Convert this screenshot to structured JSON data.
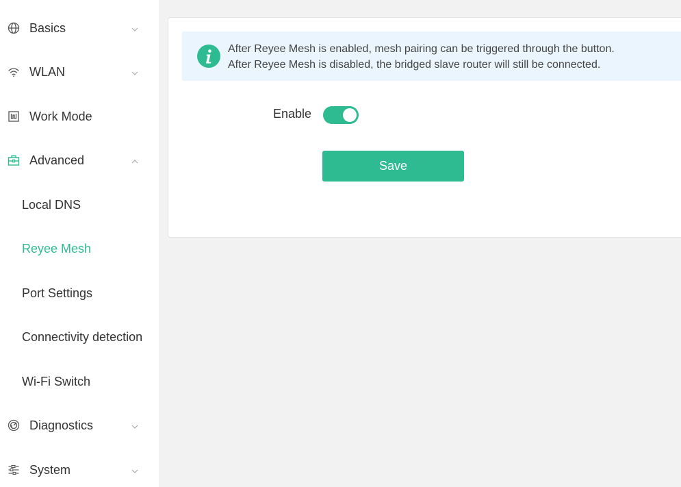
{
  "sidebar": {
    "basics": {
      "label": "Basics",
      "icon": "globe-icon"
    },
    "wlan": {
      "label": "WLAN",
      "icon": "wifi-icon"
    },
    "work_mode": {
      "label": "Work Mode",
      "icon": "work-mode-icon"
    },
    "advanced": {
      "label": "Advanced",
      "icon": "toolbox-icon",
      "children": [
        {
          "label": "Local DNS"
        },
        {
          "label": "Reyee Mesh",
          "active": true
        },
        {
          "label": "Port Settings"
        },
        {
          "label": "Connectivity detection"
        },
        {
          "label": "Wi-Fi Switch"
        }
      ]
    },
    "diagnostics": {
      "label": "Diagnostics",
      "icon": "diagnostics-icon"
    },
    "system": {
      "label": "System",
      "icon": "system-icon"
    }
  },
  "main": {
    "alert": {
      "line1": "After Reyee Mesh is enabled, mesh pairing can be triggered through the button.",
      "line2": "After Reyee Mesh is disabled, the bridged slave router will still be connected."
    },
    "enable_label": "Enable",
    "enable_on": true,
    "save_label": "Save"
  },
  "colors": {
    "accent": "#2fbb91",
    "alert_bg": "#eaf5fd",
    "page_bg": "#f2f2f2"
  }
}
